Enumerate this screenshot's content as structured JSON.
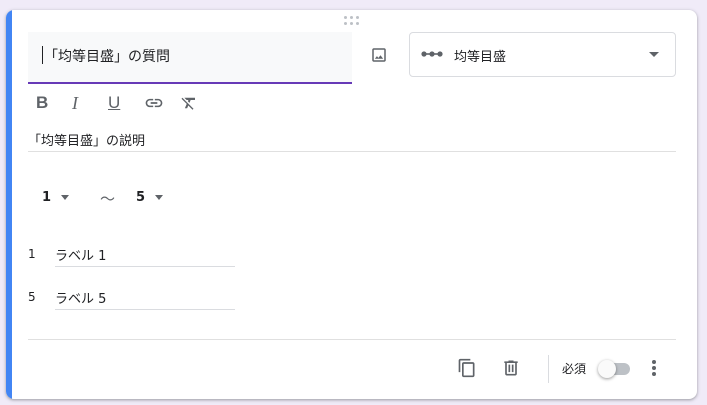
{
  "question": {
    "title_placeholder": "「均等目盛」の質問",
    "description_placeholder": "「均等目盛」の説明",
    "type_label": "均等目盛"
  },
  "formatting": {
    "bold": "B",
    "italic": "I",
    "underline": "U"
  },
  "scale": {
    "min_value": "1",
    "separator": "〜",
    "max_value": "5",
    "min_label_num": "1",
    "min_label": "ラベル 1",
    "max_label_num": "5",
    "max_label": "ラベル 5"
  },
  "footer": {
    "required_label": "必須",
    "required_on": false
  },
  "colors": {
    "accent": "#4285f4",
    "focus_underline": "#673ab7",
    "background": "#f0ebf8"
  },
  "icons": [
    "drag-handle-icon",
    "image-icon",
    "linear-scale-icon",
    "dropdown-arrow-icon",
    "link-icon",
    "clear-format-icon",
    "duplicate-icon",
    "trash-icon",
    "more-vert-icon"
  ]
}
